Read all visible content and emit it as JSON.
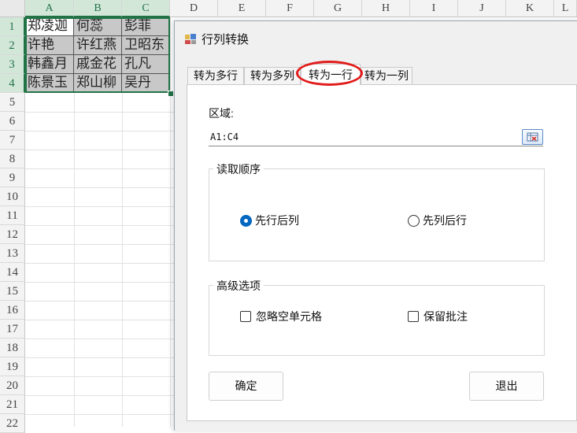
{
  "sheet": {
    "columns": [
      "A",
      "B",
      "C",
      "D",
      "E",
      "F",
      "G",
      "H",
      "I",
      "J",
      "K",
      "L"
    ],
    "rows": [
      "1",
      "2",
      "3",
      "4",
      "5",
      "6",
      "7",
      "8",
      "9",
      "10",
      "11",
      "12",
      "13",
      "14",
      "15",
      "16",
      "17",
      "18",
      "19",
      "20",
      "21",
      "22"
    ],
    "cells": [
      [
        "郑凌迦",
        "何蕊",
        "彭菲"
      ],
      [
        "许艳",
        "许红燕",
        "卫昭东"
      ],
      [
        "韩鑫月",
        "戚金花",
        "孔凡"
      ],
      [
        "陈景玉",
        "郑山柳",
        "吴丹"
      ]
    ]
  },
  "dialog": {
    "title": "行列转换",
    "tabs": [
      "转为多行",
      "转为多列",
      "转为一行",
      "转为一列"
    ],
    "active_tab": 2,
    "range_label": "区域:",
    "range_value": "A1:C4",
    "read_order": {
      "legend": "读取顺序",
      "options": [
        "先行后列",
        "先列后行"
      ],
      "selected": 0
    },
    "advanced": {
      "legend": "高级选项",
      "options": [
        "忽略空单元格",
        "保留批注"
      ]
    },
    "ok_label": "确定",
    "exit_label": "退出",
    "accent_color": "#0067c0",
    "highlight_color": "#e21b1b"
  }
}
